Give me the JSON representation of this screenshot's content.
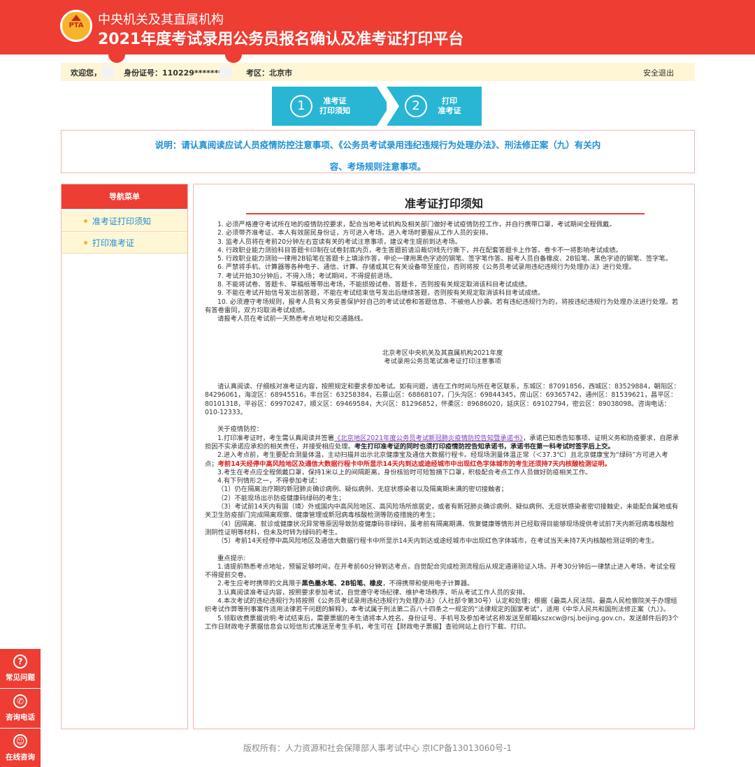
{
  "header": {
    "logo_text": "PTA",
    "title_line1": "中央机关及其直属机构",
    "title_line2": "2021年度考试录用公务员报名确认及准考证打印平台"
  },
  "infobar": {
    "welcome": "欢迎您，",
    "id_label": "身份证号：110229********",
    "area": "考区：北京市",
    "logout": "安全退出"
  },
  "steps": [
    {
      "num": "1",
      "line1": "准考证",
      "line2": "打印须知"
    },
    {
      "num": "2",
      "line1": "打印",
      "line2": "准考证"
    }
  ],
  "notice": {
    "line1": "说明：请认真阅读应试人员疫情防控注意事项、《公务员考试录用违纪违规行为处理办法》、刑法修正案（九）有关内",
    "line2": "容、考场规则注意事项。"
  },
  "sidebar": {
    "header": "导航菜单",
    "items": [
      {
        "label": "准考证打印须知"
      },
      {
        "label": "打印准考证"
      }
    ]
  },
  "content": {
    "title": "准考证打印须知",
    "rules": [
      "1. 必须严格遵守考试所在地的疫情防控要求，配合当地考试机构及相关部门做好考试疫情防控工作，并自行携带口罩，考试期间全程佩戴。",
      "2. 必须带齐准考证、本人有效居民身份证，方可进入考场。进入考场时要服从工作人员的安排。",
      "3. 监考人员将在考前20分钟左右宣读有关的考试注意事项，建议考生提前到达考场。",
      "4. 行政职业能力测验科目答题卡印制在试卷封底内页，考生答题前请沿裁切线先行撕下，并在配套答题卡上作答。卷卡不一将影响考试成绩。",
      "5. 行政职业能力测验一律用2B铅笔在答题卡上填涂作答，申论一律用黑色字迹的钢笔、签字笔作答。报考人员自备橡皮、2B铅笔、黑色字迹的钢笔、签字笔。",
      "6. 严禁将手机、计算器等各种电子、通信、计算、存储或其它有关设备带至座位，否则将按《公务员考试录用违纪违规行为处理办法》进行处理。",
      "7. 考试开始30分钟后，不得入场；考试期间，不得提前退场。",
      "8. 不能将试卷、答题卡、草稿纸等带出考场，不能损毁试卷、答题卡，否则按有关规定取消该科目考试成绩。",
      "9. 不能在考试开始信号发出前答题，不能在考试结束信号发出后继续答题，否则按有关规定取消该科目考试成绩。",
      "10. 必须遵守考场规则，报考人员有义务妥善保护好自己的考试试卷和答题信息、不被他人抄袭。若有违纪违规行为的，将按违纪违规行为处理办法进行处理。若有答卷雷同，双方均取消考试成绩。",
      "请报考人员在考试前一天熟悉考点地址和交通路线。"
    ],
    "section_title1": "北京考区中央机关及其直属机构2021年度",
    "section_title2": "考试录用公务员笔试准考证打印注意事项",
    "contact": "请认真阅读、仔细核对准考证内容，按照规定和要求参加考试。如有问题，请在工作时间与所在考区联系，东城区：87091856，西城区：83529884，朝阳区：84296061，海淀区：68945516，丰台区：63258384，石景山区：68868107，门头沟区：69844345，房山区：69365742，通州区：81539621，昌平区：80101318，平谷区：69970247，顺义区：69469584，大兴区：81296852，怀柔区：89686020，延庆区：69102794，密云区：89038098。咨询电话：010-12333。",
    "epidemic_title": "关于疫情防控：",
    "epi1_a": "1.打印准考证时，考生需认真阅读并签署",
    "epi1_link": "《北京地区2021年度公务员考试新冠肺炎疫情防控告知暨承诺书》",
    "epi1_b": "，承诺已知悉告知事项、证明义务和防疫要求，自愿承担因不实承诺应承担的相关责任，并接受相应处理。",
    "epi1_bold": "考生打印准考证的同时也须打印疫情防控告知承诺书，承诺书在第一科考试时签字后上交。",
    "epi2_a": "2.进入考点前，考生要配合测量体温，主动扫描并出示北京健康宝及通信大数据行程卡。经现场测量体温正常（＜37.3℃）且北京健康宝为“绿码”方可进入考点；",
    "epi2_red": "考前14天经停中高风险地区及通信大数据行程卡中所显示14天内到达或途经城市中出现红色字体城市的考生还须持7天内核酸检测证明。",
    "epi3": "3.考生在考点应全程佩戴口罩，保持1米以上的间隔距离，身份核验时可短暂摘下口罩，积极配合考点工作人员做好防疫相关工作。",
    "epi4": "4.有下列情形之一，不得参加考试：",
    "epi4_items": [
      "（1）仍在隔离治疗期的新冠肺炎确诊病例、疑似病例、无症状感染者以及隔离期未满的密切接触者；",
      "（2）不能现场出示防疫健康码绿码的考生；",
      "（3）考试前14天内有国（境）外或国内中高风险地区、高风险场所旅居史，或者有新冠肺炎确诊病例、疑似病例、无症状感染者密切接触史，未能配合属地或有关卫生防疫部门完成隔离观察、健康管理或新冠病毒核酸检测等防疫措施的考生；",
      "（4）因隔离、就诊或健康状况异常等原因导致防疫健康码非绿码，虽考前有隔离期满、恢复健康等情形并已经取得目能够现场提供考试前7天内新冠病毒核酸检测阴性证明等材料，但未及时转为绿码的考生。",
      "（5）考前14天经停中高风险地区及通信大数据行程卡中所显示14天内到达或途经城市中出现红色字体城市，在考试当天未持7天内核酸检测证明的考生。"
    ],
    "key_title": "重点提示:",
    "key1": "1.请提前熟悉考点地址，预留足够时间，在开考前60分钟到达考点，自觉配合完成检测流程后从规定通道验证入场。开考30分钟后一律禁止进入考场，考试全程不得提前交卷。",
    "key2_a": "2.考生应考时携带的文具限于",
    "key2_bold": "黑色墨水笔、2B铅笔、橡皮",
    "key2_b": "，不得携带和使用电子计算器。",
    "key3": "3.认真阅读准考证内容，按照要求参加考试，自觉遵守考场纪律、维护考场秩序，听从考试工作人员的安排。",
    "key4": "4.本次考试的违纪违规行为将按照《公务员考试录用违纪违规行为处理办法》（人社部令第30号）认定和处理；根据《最高人民法院、最高人民检察院关于办理组织考试作弊等刑事案件适用法律若干问题的解释》，本考试属于刑法第二百八十四条之一规定的“法律规定的国家考试”，适用《中华人民共和国刑法修正案（九）》。",
    "key5": "5.领取收费票据说明:考试结束后，需要票据的考生请将本人姓名、身份证号、手机号及参加考试名称发送至邮箱kszxcw@rsj.beijing.gov.cn，发送邮件后的3个工作日财政电子票据信息会以短信形式推送至考生手机，考生可在【财政电子票据】查验网站上自行下载、打印。"
  },
  "footer": "版权所有：人力资源和社会保障部人事考试中心 京ICP备13013060号-1",
  "float_buttons": [
    {
      "icon": "?",
      "label": "常见问题"
    },
    {
      "icon": "✆",
      "label": "咨询电话"
    },
    {
      "icon": "☺",
      "label": "在线咨询"
    }
  ]
}
